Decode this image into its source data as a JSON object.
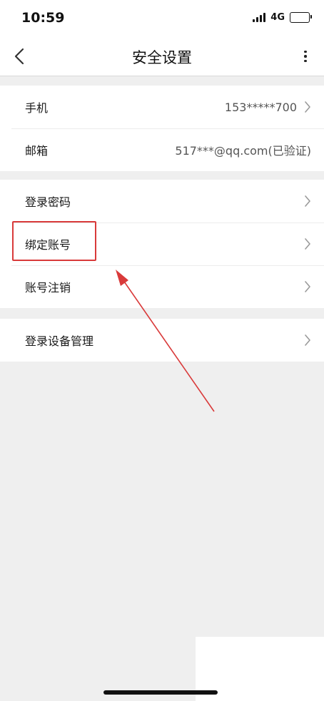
{
  "status_bar": {
    "time": "10:59",
    "network": "4G"
  },
  "nav": {
    "title": "安全设置"
  },
  "groups": [
    {
      "items": [
        {
          "label": "手机",
          "value": "153*****700",
          "chevron": true
        },
        {
          "label": "邮箱",
          "value": "517***@qq.com(已验证)",
          "chevron": false
        }
      ]
    },
    {
      "items": [
        {
          "label": "登录密码",
          "chevron": true
        },
        {
          "label": "绑定账号",
          "chevron": true
        },
        {
          "label": "账号注销",
          "chevron": true
        }
      ]
    },
    {
      "items": [
        {
          "label": "登录设备管理",
          "chevron": true
        }
      ]
    }
  ],
  "annotation": {
    "color": "#d93a3a"
  },
  "colors": {
    "background": "#efefef",
    "card": "#ffffff",
    "text": "#1a1a1a"
  }
}
